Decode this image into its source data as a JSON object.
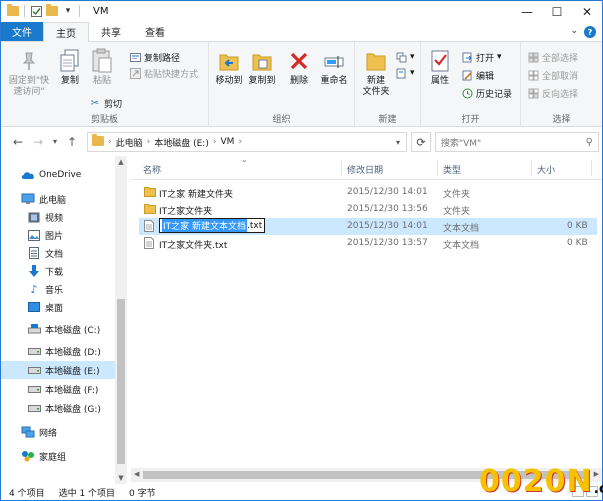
{
  "window": {
    "title": "VM"
  },
  "tabs": [
    {
      "label": "文件"
    },
    {
      "label": "主页"
    },
    {
      "label": "共享"
    },
    {
      "label": "查看"
    }
  ],
  "ribbon": {
    "clipboard": {
      "group_label": "剪贴板",
      "pin_label_1": "固定到\"快",
      "pin_label_2": "速访问\"",
      "copy_label": "复制",
      "paste_label": "粘贴",
      "copy_path": "复制路径",
      "paste_shortcut": "粘贴快捷方式",
      "cut": "剪切"
    },
    "organize": {
      "group_label": "组织",
      "move_to": "移动到",
      "copy_to": "复制到",
      "delete": "删除",
      "rename": "重命名"
    },
    "new": {
      "group_label": "新建",
      "new_folder_1": "新建",
      "new_folder_2": "文件夹"
    },
    "open": {
      "group_label": "打开",
      "properties": "属性",
      "open": "打开",
      "edit": "编辑",
      "history": "历史记录"
    },
    "select": {
      "group_label": "选择",
      "select_all": "全部选择",
      "select_none": "全部取消",
      "invert": "反向选择"
    }
  },
  "address": {
    "crumbs": [
      "此电脑",
      "本地磁盘 (E:)",
      "VM"
    ],
    "search_placeholder": "搜索\"VM\""
  },
  "nav": {
    "items": [
      {
        "label": "OneDrive"
      },
      {
        "label": "此电脑"
      },
      {
        "label": "视频"
      },
      {
        "label": "图片"
      },
      {
        "label": "文档"
      },
      {
        "label": "下载"
      },
      {
        "label": "音乐"
      },
      {
        "label": "桌面"
      },
      {
        "label": "本地磁盘 (C:)"
      },
      {
        "label": "本地磁盘 (D:)"
      },
      {
        "label": "本地磁盘 (E:)"
      },
      {
        "label": "本地磁盘 (F:)"
      },
      {
        "label": "本地磁盘 (G:)"
      },
      {
        "label": "网络"
      },
      {
        "label": "家庭组"
      }
    ]
  },
  "columns": {
    "name": "名称",
    "modified": "修改日期",
    "type": "类型",
    "size": "大小"
  },
  "files": [
    {
      "name": "IT之家 新建文件夹",
      "modified": "2015/12/30 14:01",
      "type": "文件夹",
      "size": "",
      "kind": "folder"
    },
    {
      "name": "IT之家文件夹",
      "modified": "2015/12/30 13:56",
      "type": "文件夹",
      "size": "",
      "kind": "folder"
    },
    {
      "name": "IT之家 新建文本文档.txt",
      "modified": "2015/12/30 14:01",
      "type": "文本文档",
      "size": "0 KB",
      "kind": "text",
      "rename_selected": "IT之家 新建文本文档",
      "rename_ext": ".txt"
    },
    {
      "name": "IT之家文件夹.txt",
      "modified": "2015/12/30 13:57",
      "type": "文本文档",
      "size": "0 KB",
      "kind": "text"
    }
  ],
  "status": {
    "count": "4 个项目",
    "selected": "选中 1 个项目",
    "bytes": "0 字节"
  },
  "watermark": {
    "main": "0020N",
    "suffix": ".cn"
  },
  "colors": {
    "accent": "#1979ca",
    "selection": "#cce8ff",
    "folder": "#e9b74a"
  }
}
